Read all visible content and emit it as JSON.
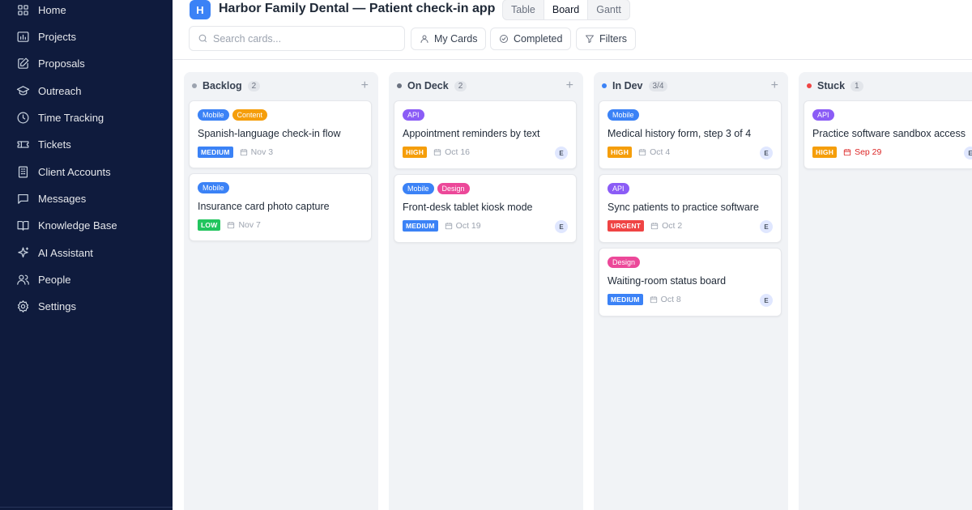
{
  "sidebar": {
    "items": [
      {
        "label": "Home",
        "icon": "grid-icon"
      },
      {
        "label": "Projects",
        "icon": "chart-icon"
      },
      {
        "label": "Proposals",
        "icon": "edit-icon"
      },
      {
        "label": "Outreach",
        "icon": "graduation-icon"
      },
      {
        "label": "Time Tracking",
        "icon": "clock-icon"
      },
      {
        "label": "Tickets",
        "icon": "ticket-icon"
      },
      {
        "label": "Client Accounts",
        "icon": "building-icon"
      },
      {
        "label": "Messages",
        "icon": "message-icon"
      },
      {
        "label": "Knowledge Base",
        "icon": "book-icon"
      },
      {
        "label": "AI Assistant",
        "icon": "sparkle-icon"
      },
      {
        "label": "People",
        "icon": "users-icon"
      },
      {
        "label": "Settings",
        "icon": "gear-icon"
      }
    ]
  },
  "header": {
    "logo_letter": "H",
    "title": "Harbor Family Dental — Patient check-in app",
    "views": [
      "Table",
      "Board",
      "Gantt"
    ],
    "active_view": "Board",
    "search_placeholder": "Search cards...",
    "my_cards": "My Cards",
    "completed": "Completed",
    "filters": "Filters"
  },
  "colors": {
    "Mobile": "#3b82f6",
    "Content": "#f59e0b",
    "API": "#8b5cf6",
    "Design": "#ec4899",
    "MEDIUM": "#3b82f6",
    "LOW": "#22c55e",
    "HIGH": "#f59e0b",
    "URGENT": "#ef4444"
  },
  "columns": [
    {
      "title": "Backlog",
      "count": "2",
      "dot": "#9ca3af",
      "cards": [
        {
          "tags": [
            "Mobile",
            "Content"
          ],
          "title": "Spanish-language check-in flow",
          "priority": "MEDIUM",
          "date": "Nov 3",
          "avatar": ""
        },
        {
          "tags": [
            "Mobile"
          ],
          "title": "Insurance card photo capture",
          "priority": "LOW",
          "date": "Nov 7",
          "avatar": ""
        }
      ]
    },
    {
      "title": "On Deck",
      "count": "2",
      "dot": "#6b7280",
      "cards": [
        {
          "tags": [
            "API"
          ],
          "title": "Appointment reminders by text",
          "priority": "HIGH",
          "date": "Oct 16",
          "avatar": "E"
        },
        {
          "tags": [
            "Mobile",
            "Design"
          ],
          "title": "Front-desk tablet kiosk mode",
          "priority": "MEDIUM",
          "date": "Oct 19",
          "avatar": "E"
        }
      ]
    },
    {
      "title": "In Dev",
      "count": "3/4",
      "dot": "#3b82f6",
      "cards": [
        {
          "tags": [
            "Mobile"
          ],
          "title": "Medical history form, step 3 of 4",
          "priority": "HIGH",
          "date": "Oct 4",
          "avatar": "E"
        },
        {
          "tags": [
            "API"
          ],
          "title": "Sync patients to practice software",
          "priority": "URGENT",
          "date": "Oct 2",
          "avatar": "E"
        },
        {
          "tags": [
            "Design"
          ],
          "title": "Waiting-room status board",
          "priority": "MEDIUM",
          "date": "Oct 8",
          "avatar": "E"
        }
      ]
    },
    {
      "title": "Stuck",
      "count": "1",
      "dot": "#ef4444",
      "cards": [
        {
          "tags": [
            "API"
          ],
          "title": "Practice software sandbox access",
          "priority": "HIGH",
          "date": "Sep 29",
          "overdue": true,
          "avatar": "E"
        }
      ]
    }
  ]
}
